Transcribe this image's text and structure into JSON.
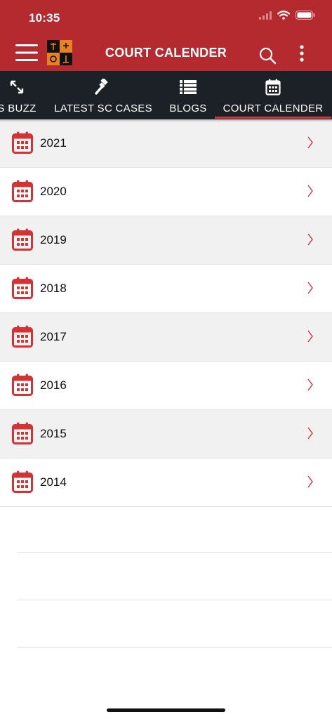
{
  "status": {
    "time": "10:35"
  },
  "header": {
    "title": "COURT CALENDER"
  },
  "tabs": [
    {
      "label": "S BUZZ",
      "icon": "arrows-icon"
    },
    {
      "label": "LATEST SC CASES",
      "icon": "gavel-icon"
    },
    {
      "label": "BLOGS",
      "icon": "list-icon"
    },
    {
      "label": "COURT CALENDER",
      "icon": "calendar-icon",
      "active": true
    }
  ],
  "years": [
    "2021",
    "2020",
    "2019",
    "2018",
    "2017",
    "2016",
    "2015",
    "2014"
  ],
  "colors": {
    "brand": "#b52a2f",
    "tabbar": "#1c2127",
    "accent": "#d4373b",
    "row_alt": "#f1f1f1"
  }
}
